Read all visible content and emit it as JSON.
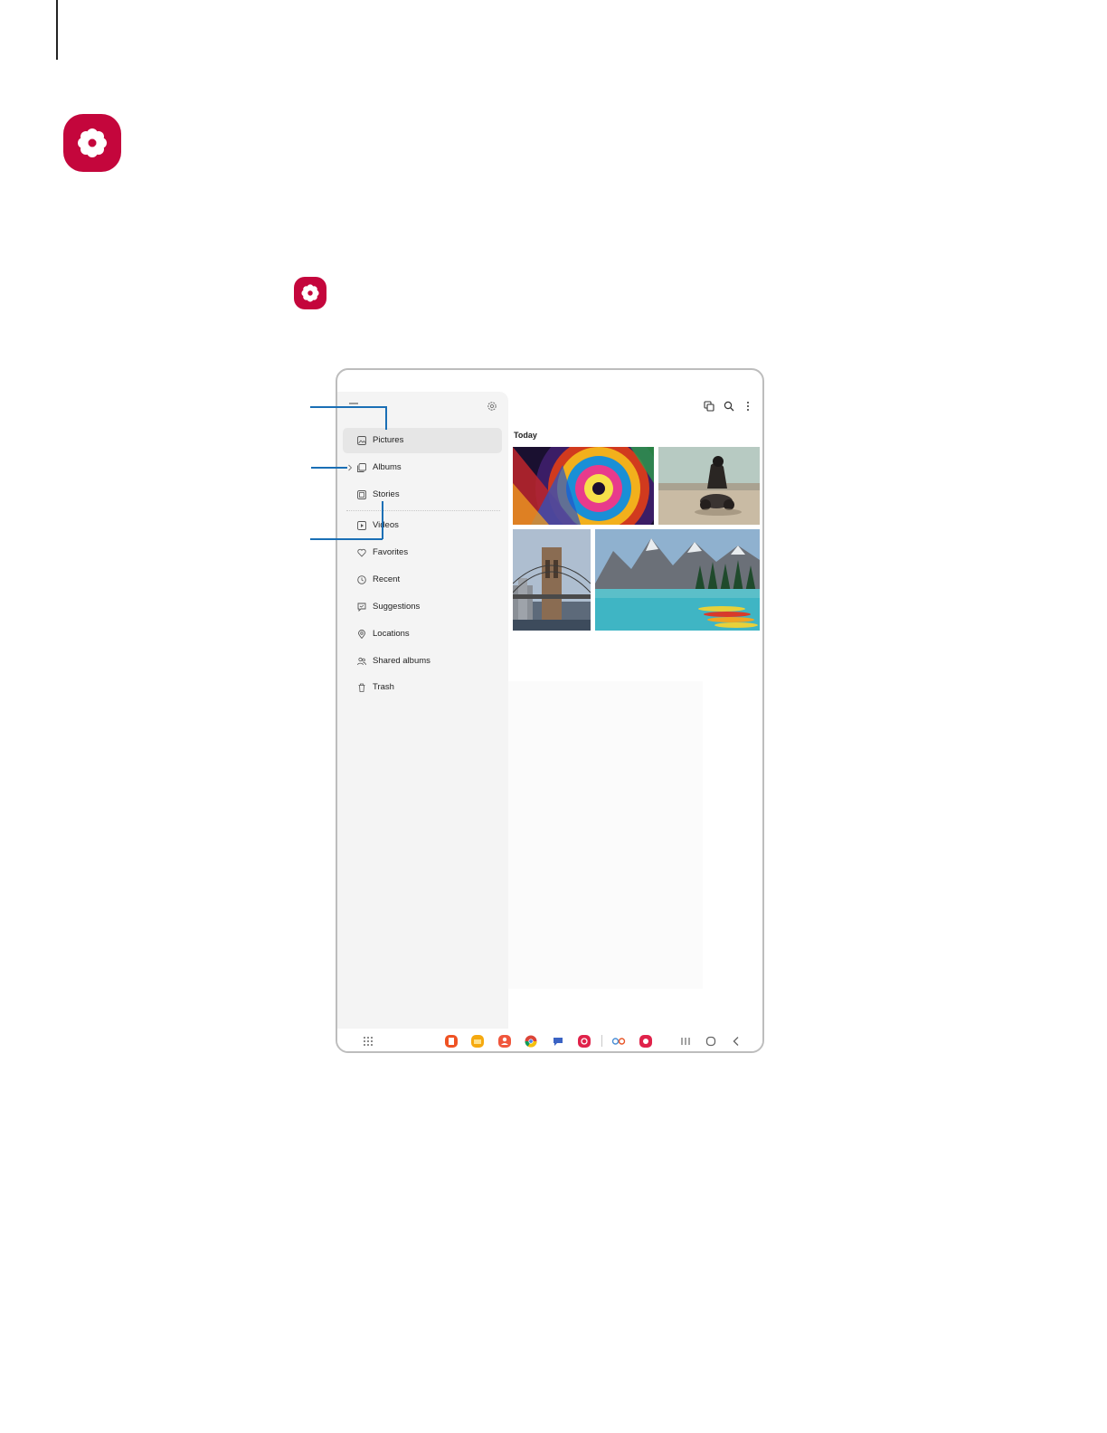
{
  "brand": {
    "accent": "#c4063c",
    "callout": "#1a6fb5"
  },
  "sidebar": {
    "items": [
      {
        "label": "Pictures",
        "icon": "image-icon"
      },
      {
        "label": "Albums",
        "icon": "album-icon"
      },
      {
        "label": "Stories",
        "icon": "stories-icon"
      },
      {
        "label": "Videos",
        "icon": "video-icon"
      },
      {
        "label": "Favorites",
        "icon": "heart-icon"
      },
      {
        "label": "Recent",
        "icon": "clock-icon"
      },
      {
        "label": "Suggestions",
        "icon": "suggestions-icon"
      },
      {
        "label": "Locations",
        "icon": "location-pin-icon"
      },
      {
        "label": "Shared albums",
        "icon": "people-icon"
      },
      {
        "label": "Trash",
        "icon": "trash-icon"
      }
    ]
  },
  "main": {
    "section_label": "Today",
    "toolbar_icons": [
      "multi-select-icon",
      "search-icon",
      "more-options-icon"
    ],
    "thumbnails": [
      "stained-glass-dome-photo",
      "motorcycle-rider-photo",
      "brooklyn-bridge-photo",
      "mountain-lake-canoes-photo"
    ]
  },
  "taskbar": {
    "apps": [
      "app-drawer-icon",
      "notes-app-icon",
      "files-app-icon",
      "contacts-app-icon",
      "chrome-app-icon",
      "messages-app-icon",
      "camera-app-icon",
      "recent-apps-pair-icon",
      "gallery-app-icon"
    ],
    "nav_buttons": [
      "recents-button",
      "home-button",
      "back-button"
    ]
  }
}
